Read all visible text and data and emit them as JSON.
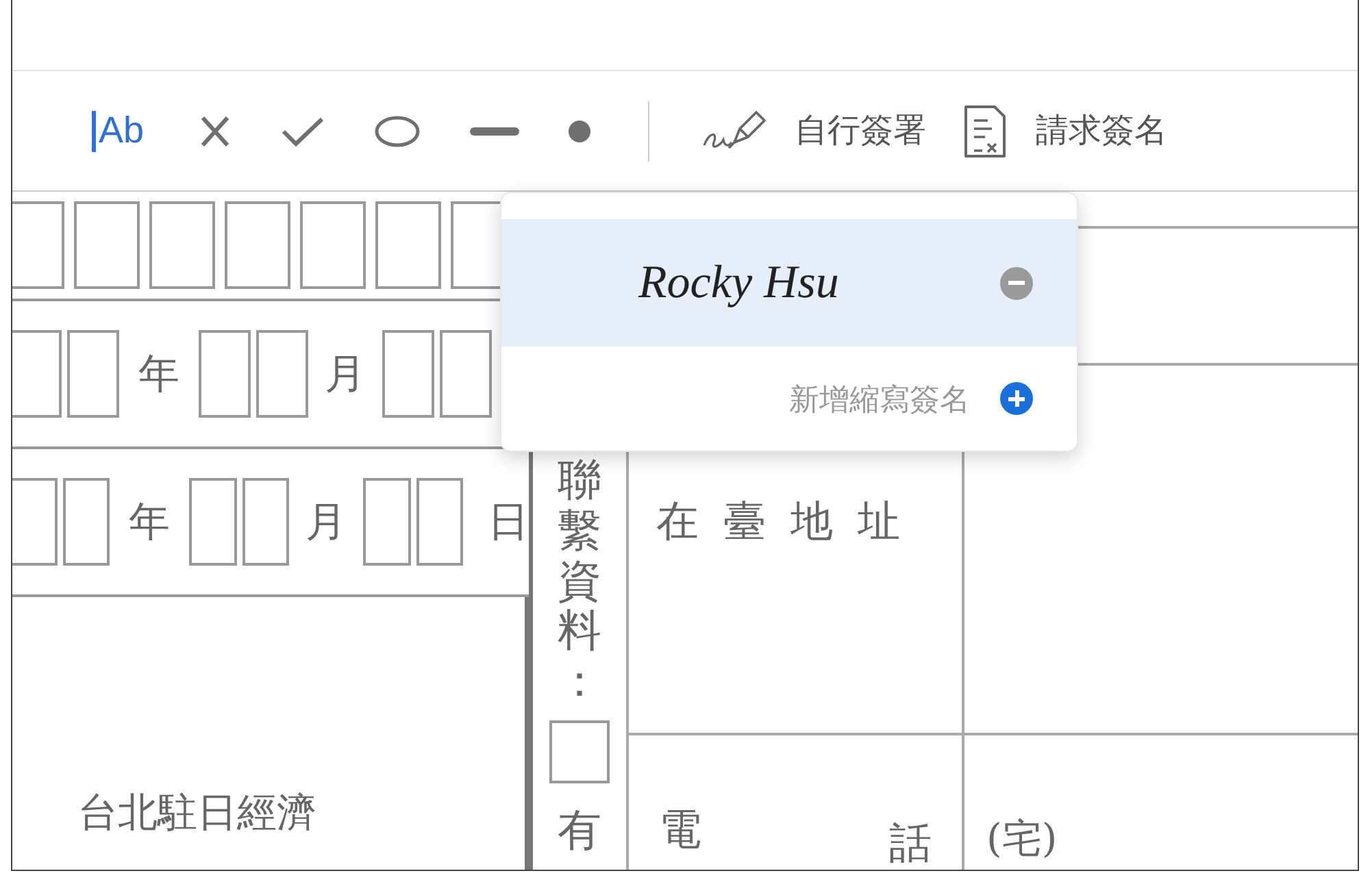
{
  "toolbar": {
    "tools": [
      {
        "kind": "text",
        "label": "Ab",
        "selected": true
      },
      {
        "kind": "cross",
        "selected": false
      },
      {
        "kind": "check",
        "selected": false
      },
      {
        "kind": "ellipse",
        "selected": false
      },
      {
        "kind": "line",
        "selected": false
      },
      {
        "kind": "dot",
        "selected": false
      }
    ],
    "actions": [
      {
        "kind": "sign",
        "label": "自行簽署"
      },
      {
        "kind": "request",
        "label": "請求簽名"
      }
    ]
  },
  "signature_menu": {
    "signatures": [
      {
        "text": "Rocky Hsu",
        "selected": true
      }
    ],
    "add_initials": "新增縮寫簽名"
  },
  "document": {
    "date_rows": [
      {
        "year": "年",
        "month": "月"
      },
      {
        "year": "年",
        "month": "月",
        "day": "日"
      }
    ],
    "contact_label": "聯繫資料：",
    "contact_checkbox": {
      "label": "有",
      "checked": false
    },
    "address_label": "在臺地址",
    "phone_label": [
      "電",
      "話"
    ],
    "phone_home": "(宅)",
    "office_text": "台北駐日經濟"
  }
}
